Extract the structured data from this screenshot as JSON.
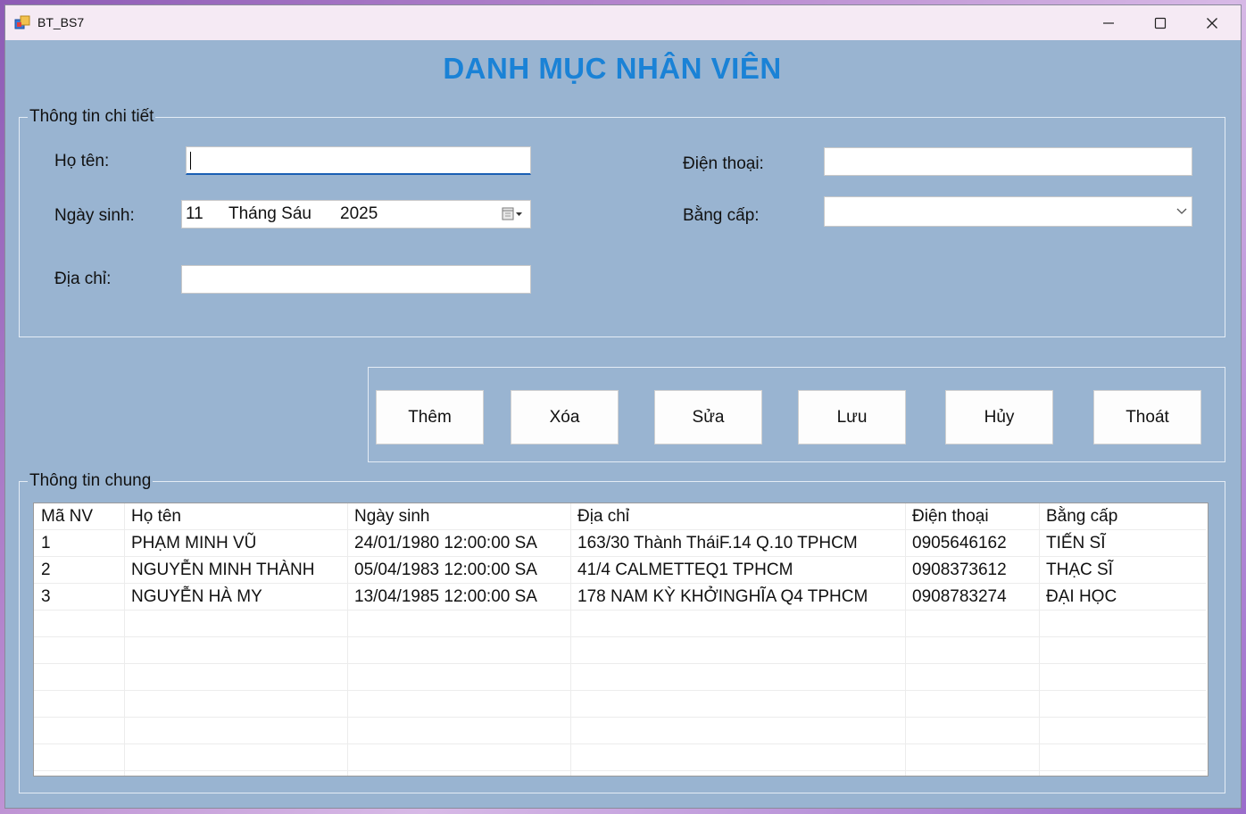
{
  "window": {
    "title": "BT_BS7"
  },
  "colors": {
    "form_background": "#99b4d1",
    "header_title": "#1a82d6",
    "titlebar": "#f5eaf4"
  },
  "header": {
    "title": "DANH MỤC NHÂN VIÊN"
  },
  "details": {
    "legend": "Thông tin chi tiết",
    "name_label": "Họ tên:",
    "name_value": "",
    "dob_label": "Ngày sinh:",
    "dob_day": "11",
    "dob_month": "Tháng Sáu",
    "dob_year": "2025",
    "address_label": "Địa chỉ:",
    "address_value": "",
    "phone_label": "Điện thoại:",
    "phone_value": "",
    "degree_label": "Bằng cấp:",
    "degree_value": ""
  },
  "actions": {
    "add": "Thêm",
    "delete": "Xóa",
    "edit": "Sửa",
    "save": "Lưu",
    "cancel": "Hủy",
    "exit": "Thoát"
  },
  "general": {
    "legend": "Thông tin chung"
  },
  "table": {
    "columns": [
      "Mã NV",
      "Họ tên",
      "Ngày sinh",
      "Địa chỉ",
      "Điện thoại",
      "Bằng cấp"
    ],
    "rows": [
      [
        "1",
        "PHẠM MINH VŨ",
        "24/01/1980 12:00:00 SA",
        "163/30 Thành TháiF.14 Q.10 TPHCM",
        "0905646162",
        "TIẾN SĨ"
      ],
      [
        "2",
        "NGUYỄN MINH THÀNH",
        "05/04/1983 12:00:00 SA",
        "41/4 CALMETTEQ1 TPHCM",
        "0908373612",
        "THẠC SĨ"
      ],
      [
        "3",
        "NGUYỄN HÀ MY",
        "13/04/1985 12:00:00 SA",
        "178 NAM KỲ KHỞINGHĨA Q4 TPHCM",
        "0908783274",
        "ĐẠI HỌC"
      ]
    ]
  }
}
